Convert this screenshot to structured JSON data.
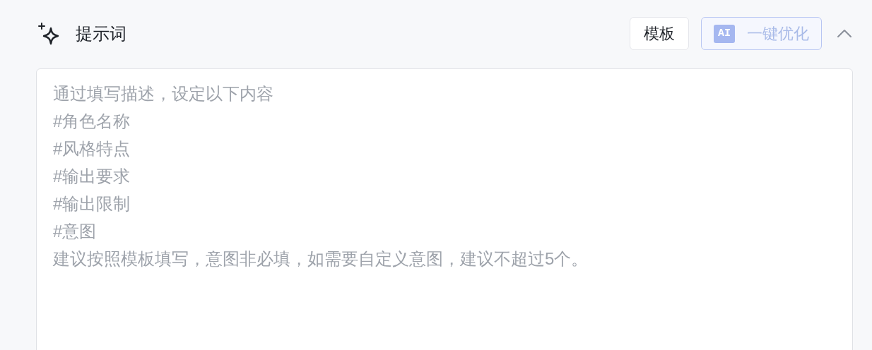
{
  "section": {
    "title": "提示词",
    "expanded": true
  },
  "buttons": [
    {
      "kind": "plain",
      "label": "模板",
      "disabled": false
    },
    {
      "kind": "ai",
      "badge": "AI",
      "label": "一键优化",
      "disabled": true
    }
  ],
  "prompt_field": {
    "placeholder_lines": [
      "通过填写描述，设定以下内容",
      "#角色名称",
      "#风格特点",
      "#输出要求",
      "#输出限制",
      "#意图",
      "建议按照模板填写，意图非必填，如需要自定义意图，建议不超过5个。"
    ]
  }
}
